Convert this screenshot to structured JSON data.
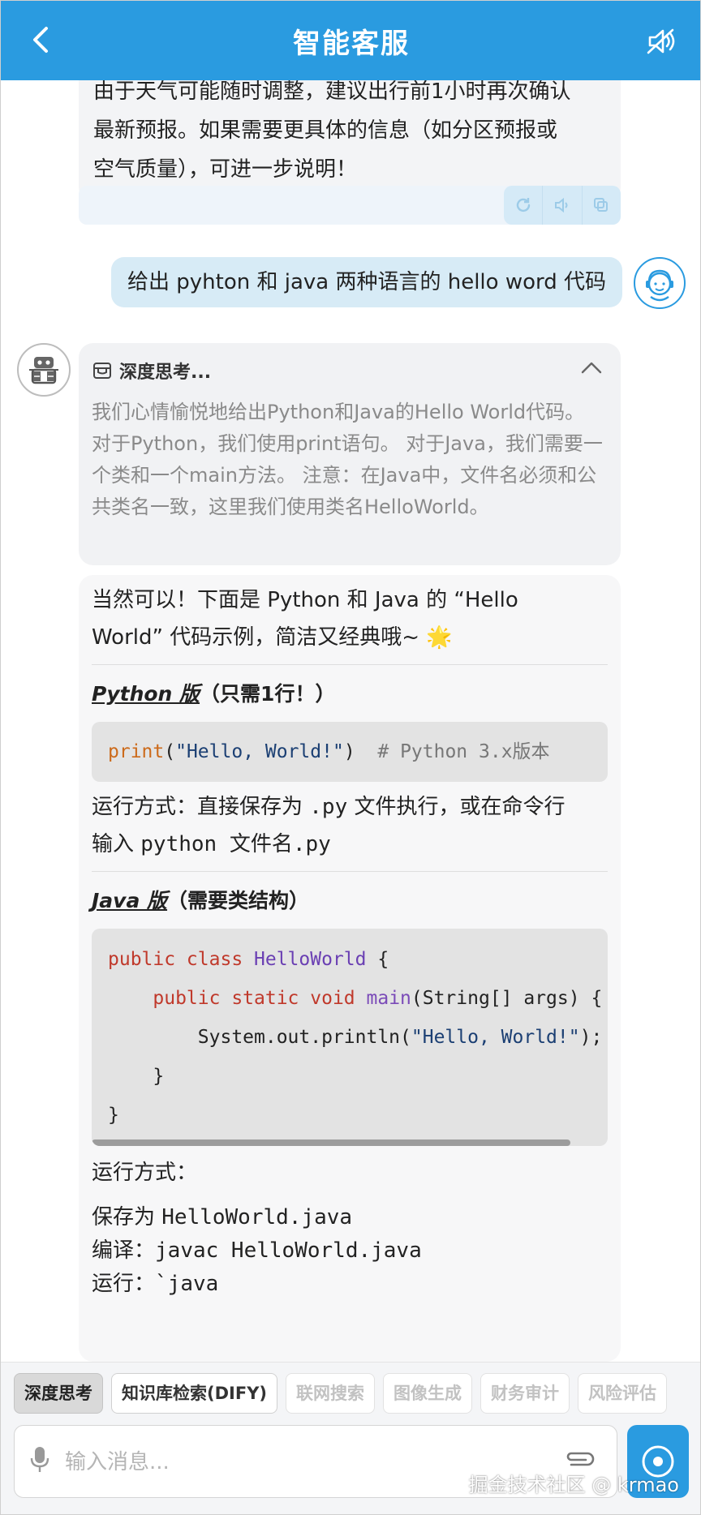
{
  "header": {
    "title": "智能客服"
  },
  "prev_message": {
    "lines": [
      "由于天气可能随时调整，建议出行前1小时再次确认",
      "最新预报。如果需要更具体的信息（如分区预报或",
      "空气质量），可进一步说明！"
    ]
  },
  "user_message": {
    "text": "给出 pyhton 和 java 两种语言的 hello word 代码"
  },
  "thinking": {
    "label": "深度思考...",
    "text": "我们心情愉悦地给出Python和Java的Hello World代码。 对于Python，我们使用print语句。 对于Java，我们需要一个类和一个main方法。 注意：在Java中，文件名必须和公共类名一致，这里我们使用类名HelloWorld。"
  },
  "answer": {
    "intro_line1": "当然可以！下面是 Python 和 Java 的 “Hello",
    "intro_line2": "World” 代码示例，简洁又经典哦~ 🌟",
    "python_heading_em": "Python 版",
    "python_heading_rest": "（只需1行！）",
    "python_code": {
      "fn": "print",
      "open": "(",
      "str": "\"Hello, World!\"",
      "close": ")",
      "comment": "  # Python 3.x版本"
    },
    "run_py_line1_a": "运行方式：直接保存为 ",
    "run_py_line1_b": ".py",
    "run_py_line1_c": " 文件执行，或在命令行",
    "run_py_line2_a": "输入 ",
    "run_py_line2_b": "python 文件名.py",
    "java_heading_em": "Java 版",
    "java_heading_rest": "（需要类结构）",
    "java_code": {
      "l1_kw": "public class ",
      "l1_cls": "HelloWorld",
      "l1_rest": " {",
      "l2_indent": "    ",
      "l2_kw": "public static void ",
      "l2_fn": "main",
      "l2_rest": "(String[] args) {",
      "l3_indent": "        ",
      "l3_a": "System.out.println(",
      "l3_str": "\"Hello, World!\"",
      "l3_b": ");",
      "l4": "    }",
      "l5": "}"
    },
    "run_java_title": "运行方式：",
    "save_a": "保存为 ",
    "save_b": "HelloWorld.java",
    "compile_a": "编译：",
    "compile_b": "javac HelloWorld.java",
    "run_a": "运行：",
    "run_b": "`java"
  },
  "toolbar": {
    "chips": [
      {
        "label": "深度思考"
      },
      {
        "label": "知识库检索(DIFY)"
      },
      {
        "label": "联网搜索"
      },
      {
        "label": "图像生成"
      },
      {
        "label": "财务审计"
      },
      {
        "label": "风险评估"
      }
    ]
  },
  "input": {
    "placeholder": "输入消息..."
  },
  "watermark": "掘金技术社区 @ krmao",
  "colors": {
    "primary": "#2a9be0",
    "user_bubble": "#d7ebf6"
  }
}
